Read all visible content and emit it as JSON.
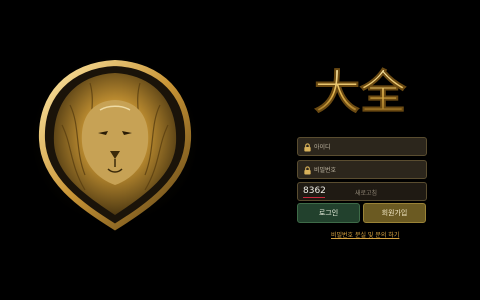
{
  "brand": {
    "logo_text": "大全"
  },
  "form": {
    "id_label": "아이디",
    "password_label": "비밀번호",
    "captcha_code": "8362",
    "captcha_label": "새로고침"
  },
  "buttons": {
    "login": "로그인",
    "join": "회원가입"
  },
  "links": {
    "find_password": "비밀번호 분실 및 문의 하기"
  },
  "icons": {
    "emblem": "golden-lion-emblem-icon",
    "id": "lock-icon",
    "password": "lock-icon"
  },
  "colors": {
    "gold": "#d9a441",
    "login_green": "#22412d",
    "join_gold": "#6b5a22"
  }
}
